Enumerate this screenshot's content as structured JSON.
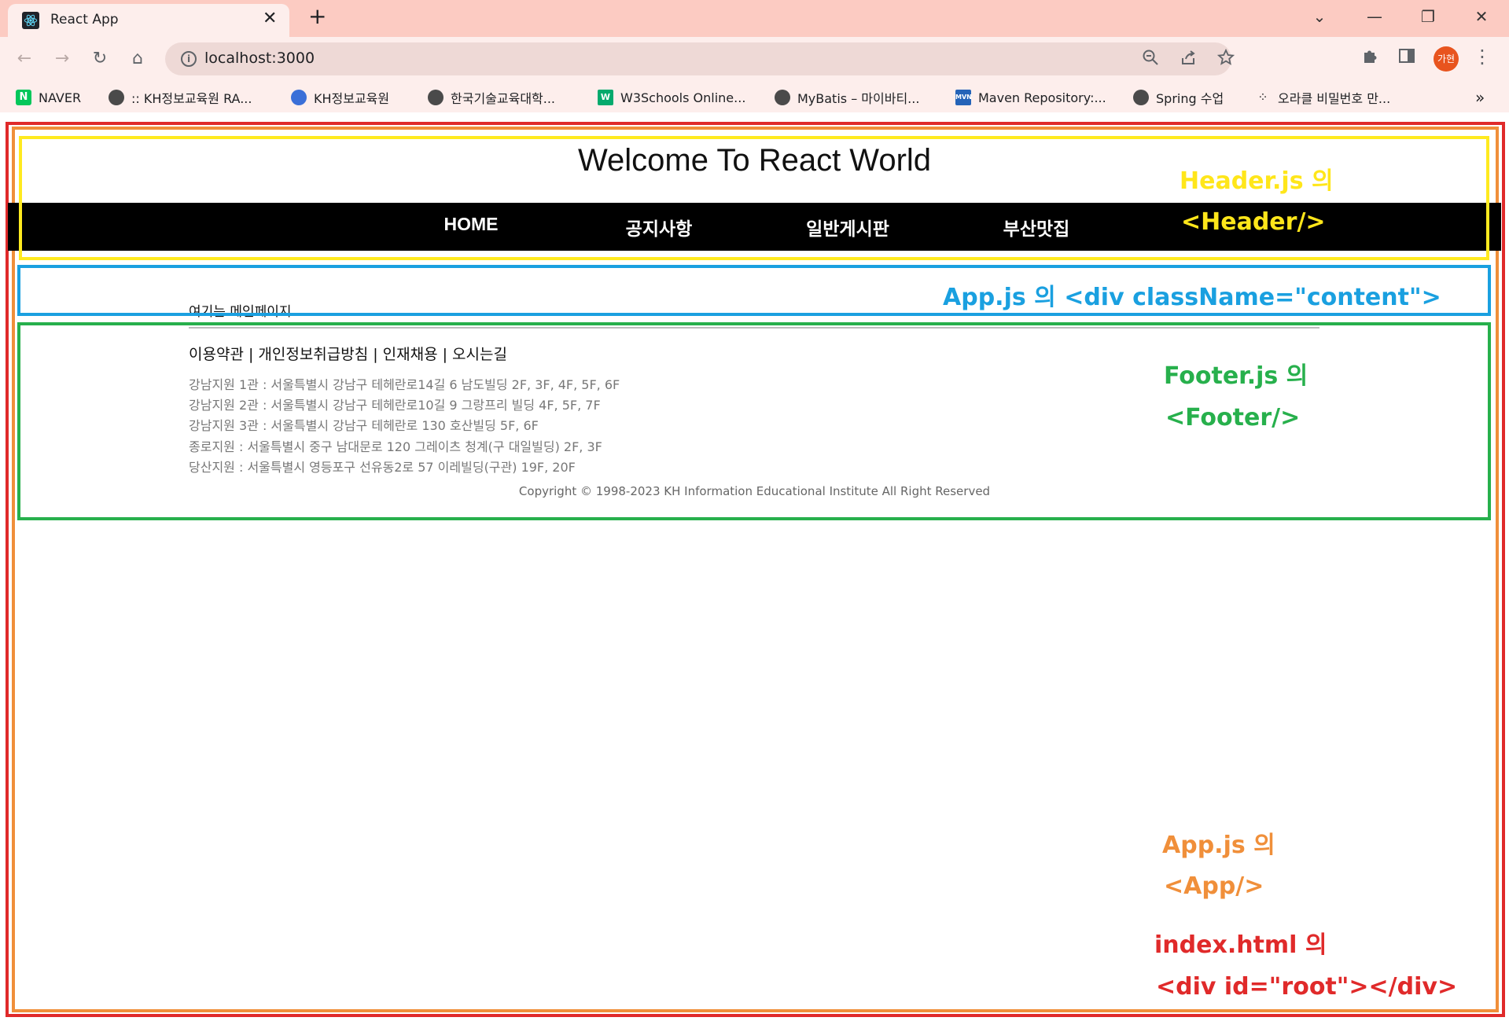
{
  "browser": {
    "tab_title": "React App",
    "tab_close": "✕",
    "new_tab": "+",
    "url": "localhost:3000",
    "avatar_text": "가현",
    "controls": {
      "back": "←",
      "forward": "→",
      "reload": "↻",
      "home": "⌂",
      "tab_search": "⌄",
      "minimize": "—",
      "restore": "❐",
      "close": "✕",
      "menu": "⋮"
    },
    "bookmarks": [
      {
        "label": "NAVER",
        "icon": "naver-icon"
      },
      {
        "label": ":: KH정보교육원 RA...",
        "icon": "globe-icon"
      },
      {
        "label": "KH정보교육원",
        "icon": "kh-icon"
      },
      {
        "label": "한국기술교육대학...",
        "icon": "globe-icon"
      },
      {
        "label": "W3Schools Online...",
        "icon": "w3schools-icon"
      },
      {
        "label": "MyBatis – 마이바티...",
        "icon": "globe-icon"
      },
      {
        "label": "Maven Repository:...",
        "icon": "maven-icon"
      },
      {
        "label": "Spring 수업",
        "icon": "globe-icon"
      },
      {
        "label": "오라클 비밀번호 만...",
        "icon": "dots-icon"
      }
    ],
    "bookmarks_more": "»"
  },
  "page": {
    "title": "Welcome To React World",
    "nav": [
      "HOME",
      "공지사항",
      "일반게시판",
      "부산맛집"
    ],
    "main_text": "여기는 메인페이지",
    "footer": {
      "links": [
        "이용약관 |",
        "개인정보취급방침 |",
        "인재채용 |",
        "오시는길"
      ],
      "addresses": [
        "강남지원 1관 : 서울특별시 강남구 테헤란로14길 6 남도빌딩 2F, 3F, 4F, 5F, 6F",
        "강남지원 2관 : 서울특별시 강남구 테헤란로10길 9 그랑프리 빌딩 4F, 5F, 7F",
        "강남지원 3관 : 서울특별시 강남구 테헤란로 130 호산빌딩 5F, 6F",
        "종로지원 : 서울특별시 중구 남대문로 120 그레이츠 청계(구 대일빌딩) 2F, 3F",
        "당산지원 : 서울특별시 영등포구 선유동2로 57 이레빌딩(구관) 19F, 20F"
      ],
      "copyright": "Copyright © 1998-2023 KH Information Educational Institute All Right Reserved"
    }
  },
  "annotations": {
    "header_line1": "Header.js 의",
    "header_line2": "<Header/>",
    "content_line": "App.js 의 <div className=\"content\">",
    "footer_line1": "Footer.js 의",
    "footer_line2": "<Footer/>",
    "app_line1": "App.js 의",
    "app_line2": "<App/>",
    "root_line1": "index.html 의",
    "root_line2": "<div id=\"root\"></div>"
  },
  "colors": {
    "header_box": "#ffea1f",
    "content_box": "#1aa0e0",
    "footer_box": "#27b04c",
    "app_box": "#f08f3a",
    "root_box": "#e02a2a",
    "nav_background": "#000000"
  }
}
